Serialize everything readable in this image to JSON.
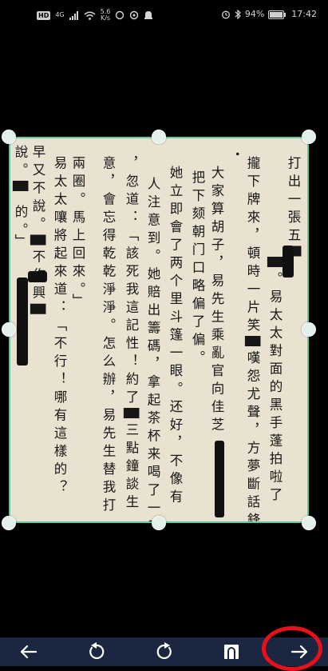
{
  "status_bar": {
    "hd_label": "HD",
    "network_label": "4G",
    "speed_value": "5.6",
    "speed_unit": "K/s",
    "battery_text": "94%",
    "time": "17:42"
  },
  "document": {
    "columns": [
      "打出一張五█",
      "█。易太太對面的黑手蓬拍啦了",
      "攏下牌來，頓時一片笑█嘆怨尤聲，方夢斷話鋒",
      "•",
      "大家算胡子，易先生乘亂官向佳芝",
      "把下颏朝门口略偏了偏。",
      "她立即會了两个里斗篷一眼。还好，不像有",
      "人注意到。她賠出籌碼，拿起茶杯来喝了一口",
      "，忽道：「該死我這記性！約了█三點鐘談生",
      "意，會忘得乾乾淨淨。怎么辦，易先生替我打",
      "兩圈。馬上回來。」",
      "易太太嚷將起來道：「不行！哪有這樣的？",
      "早又不說。█不作興█",
      "說。█ 的。」"
    ]
  },
  "toolbar": {
    "back_label": "back",
    "rotate_left_label": "rotate left",
    "rotate_right_label": "rotate right",
    "auto_crop_label": "auto crop",
    "next_label": "next"
  },
  "colors": {
    "crop_border": "#5fc7a4",
    "toolbar_bg": "#1b2741",
    "highlight": "#e8101a",
    "paper": "#e9e2d0"
  }
}
